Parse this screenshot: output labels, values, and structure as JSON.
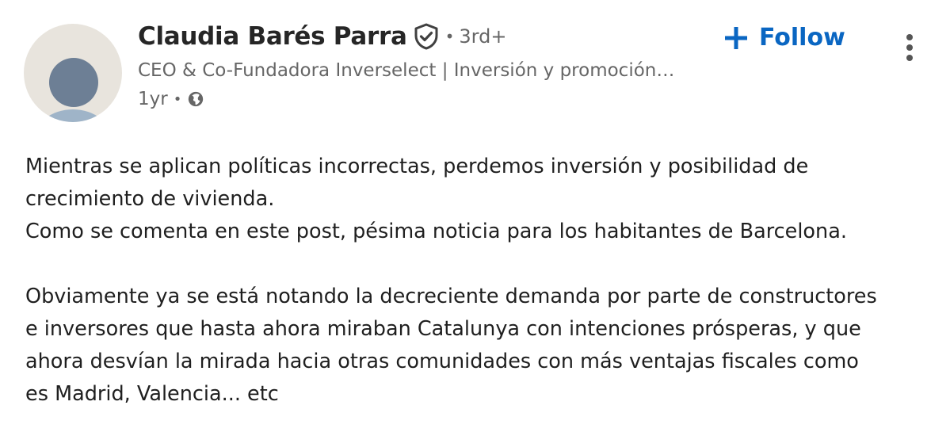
{
  "author": {
    "name": "Claudia Barés Parra",
    "degree": "3rd+",
    "headline": "CEO & Co-Fundadora Inverselect | Inversión y promoción…",
    "posted": "1yr",
    "visibility_icon": "globe-icon",
    "verified_icon": "shield-check-icon"
  },
  "actions": {
    "follow_label": "Follow",
    "follow_icon": "plus-icon",
    "more_icon": "more-vertical-icon"
  },
  "post": {
    "paragraphs": [
      "Mientras se aplican políticas incorrectas, perdemos inversión y posibilidad de\ncrecimiento de vivienda.\nComo se comenta en este post, pésima noticia para los habitantes de Barcelona.",
      "Obviamente ya se está notando la decreciente demanda por parte de constructores\ne inversores que hasta ahora miraban Catalunya con intenciones prósperas, y que\nahora desvían la mirada hacia otras comunidades con más ventajas fiscales como\nes Madrid, Valencia... etc"
    ]
  },
  "colors": {
    "accent": "#0a66c2",
    "muted_text": "#666666",
    "avatar_bg": "#e8e4dd"
  }
}
